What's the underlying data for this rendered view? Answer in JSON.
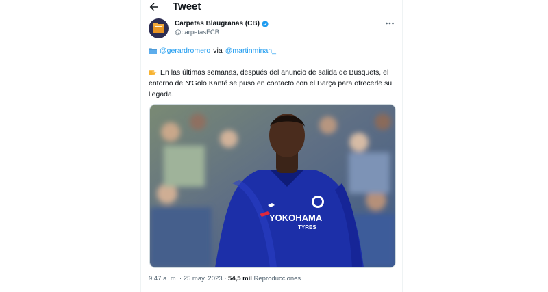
{
  "header": {
    "title": "Tweet"
  },
  "author": {
    "name": "Carpetas Blaugranas (CB)",
    "handle": "@carpetasFCB"
  },
  "tweet": {
    "mention1": "@gerardromero",
    "via": "via",
    "mention2": "@martinminan_",
    "text": "En las últimas semanas, después del anuncio de salida de Busquets, el entorno de N'Golo Kanté se puso en contacto con el Barça para ofrecerle su llegada."
  },
  "media": {
    "sponsor_text": "YOKOHAMA",
    "sponsor_sub": "TYRES"
  },
  "meta": {
    "time": "9:47 a. m.",
    "separator": "·",
    "date": "25 may. 2023",
    "views_count": "54,5 mil",
    "views_label": "Reproducciones"
  },
  "colors": {
    "accent": "#1d9bf0",
    "jersey": "#1c2fa8",
    "avatar_bg": "#2d2d52"
  },
  "icons": [
    "back-arrow-icon",
    "verified-badge-icon",
    "more-icon",
    "folder-icon",
    "pointing-hand-icon"
  ]
}
